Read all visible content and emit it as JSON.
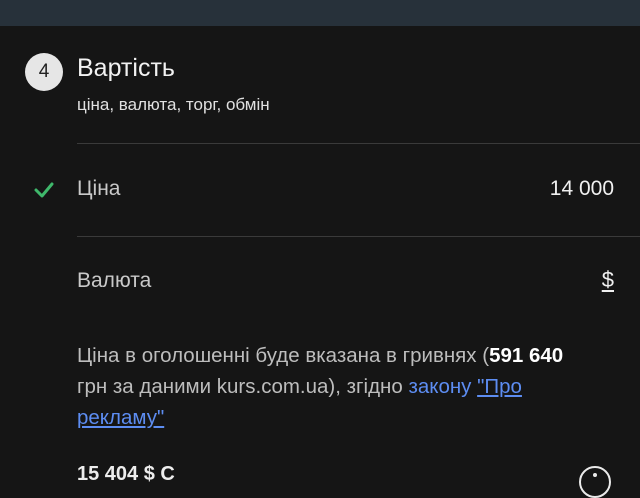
{
  "section": {
    "step_number": "4",
    "title": "Вартість",
    "subtitle": "ціна, валюта, торг, обмін"
  },
  "price_row": {
    "label": "Ціна",
    "value": "14 000",
    "completed": true
  },
  "currency_row": {
    "label": "Валюта",
    "value": "$"
  },
  "notice": {
    "text_before": "Ціна в оголошенні буде вказана в гривнях (",
    "amount": "591 640",
    "text_middle": " грн за даними kurs.com.ua), згідно ",
    "law_prefix": "закону ",
    "law_link": "\"Про рекламу\""
  },
  "next_row_partial": {
    "text": "15 404 $  С"
  },
  "colors": {
    "background": "#151515",
    "topbar": "#27313a",
    "check": "#3fb86b",
    "link": "#5d8df2"
  },
  "icons": {
    "check": "check-icon",
    "info": "info-icon"
  }
}
